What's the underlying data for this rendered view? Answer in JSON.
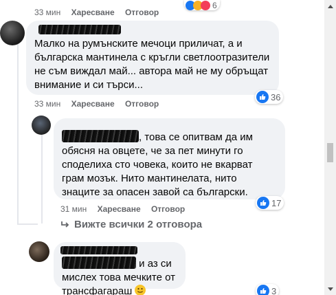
{
  "top_meta": {
    "time": "33 мин",
    "like": "Харесване",
    "reply": "Отговор",
    "reaction_count": "6"
  },
  "comment1": {
    "text": "Малко на румънските мечоци приличат, а и българска мантинела с кръгли светлоотразители не съм виждал май... автора май не му обръщат внимание и си търси...",
    "time": "33 мин",
    "like": "Харесване",
    "reply": "Отговор",
    "reaction_count": "36"
  },
  "reply1": {
    "text": ", това се опитвам да им обясня на овцете, че за пет минути го споделиха сто човека, които не вкарват грам мозък. Нито мантинелата, нито знаците за опасен завой са български.",
    "time": "31 мин",
    "like": "Харесване",
    "reply": "Отговор",
    "reaction_count": "17"
  },
  "view_replies": {
    "label": "Вижте всички 2 отговора"
  },
  "comment2": {
    "text": " и аз си мислех това мечките от трансфагараш",
    "reaction_count": "3"
  },
  "colors": {
    "accent": "#1877f2",
    "bubble": "#f0f2f5",
    "meta": "#65676b"
  },
  "icons": [
    "like-icon",
    "haha-icon",
    "love-icon",
    "reply-arrow-icon",
    "smile-emoji-icon",
    "scroll-up-icon",
    "scroll-down-icon"
  ]
}
